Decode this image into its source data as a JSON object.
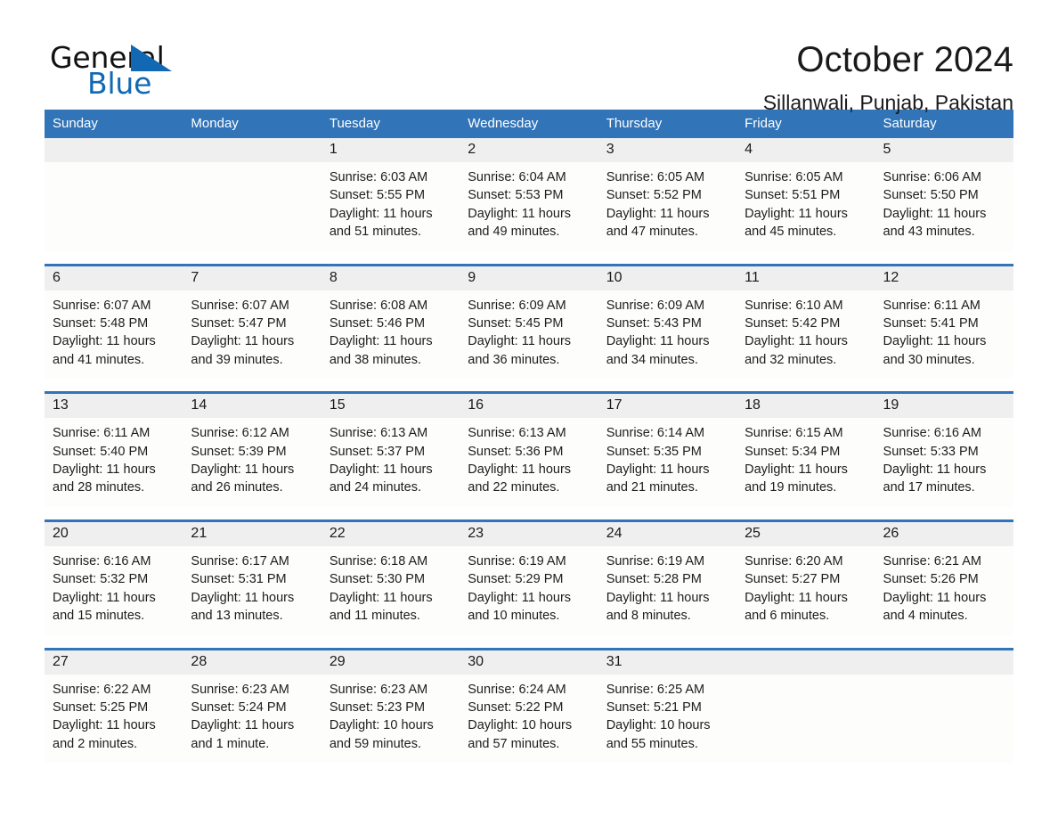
{
  "brand": {
    "name_top": "General",
    "name_bottom": "Blue",
    "flag_icon": "blue-triangle-flag-icon",
    "color_blue": "#1268b3"
  },
  "header": {
    "title": "October 2024",
    "location": "Sillanwali, Punjab, Pakistan"
  },
  "theme": {
    "header_blue": "#3174b7",
    "row_rule_blue": "#3174b7",
    "daynum_band": "#efefef",
    "cell_bg": "#fdfdfc",
    "text": "#1a1a1a"
  },
  "calendar": {
    "weekday_headers": [
      "Sunday",
      "Monday",
      "Tuesday",
      "Wednesday",
      "Thursday",
      "Friday",
      "Saturday"
    ],
    "weeks": [
      [
        {
          "day": "",
          "empty": true
        },
        {
          "day": "",
          "empty": true
        },
        {
          "day": "1",
          "sunrise": "Sunrise: 6:03 AM",
          "sunset": "Sunset: 5:55 PM",
          "daylight_line1": "Daylight: 11 hours",
          "daylight_line2": "and 51 minutes."
        },
        {
          "day": "2",
          "sunrise": "Sunrise: 6:04 AM",
          "sunset": "Sunset: 5:53 PM",
          "daylight_line1": "Daylight: 11 hours",
          "daylight_line2": "and 49 minutes."
        },
        {
          "day": "3",
          "sunrise": "Sunrise: 6:05 AM",
          "sunset": "Sunset: 5:52 PM",
          "daylight_line1": "Daylight: 11 hours",
          "daylight_line2": "and 47 minutes."
        },
        {
          "day": "4",
          "sunrise": "Sunrise: 6:05 AM",
          "sunset": "Sunset: 5:51 PM",
          "daylight_line1": "Daylight: 11 hours",
          "daylight_line2": "and 45 minutes."
        },
        {
          "day": "5",
          "sunrise": "Sunrise: 6:06 AM",
          "sunset": "Sunset: 5:50 PM",
          "daylight_line1": "Daylight: 11 hours",
          "daylight_line2": "and 43 minutes."
        }
      ],
      [
        {
          "day": "6",
          "sunrise": "Sunrise: 6:07 AM",
          "sunset": "Sunset: 5:48 PM",
          "daylight_line1": "Daylight: 11 hours",
          "daylight_line2": "and 41 minutes."
        },
        {
          "day": "7",
          "sunrise": "Sunrise: 6:07 AM",
          "sunset": "Sunset: 5:47 PM",
          "daylight_line1": "Daylight: 11 hours",
          "daylight_line2": "and 39 minutes."
        },
        {
          "day": "8",
          "sunrise": "Sunrise: 6:08 AM",
          "sunset": "Sunset: 5:46 PM",
          "daylight_line1": "Daylight: 11 hours",
          "daylight_line2": "and 38 minutes."
        },
        {
          "day": "9",
          "sunrise": "Sunrise: 6:09 AM",
          "sunset": "Sunset: 5:45 PM",
          "daylight_line1": "Daylight: 11 hours",
          "daylight_line2": "and 36 minutes."
        },
        {
          "day": "10",
          "sunrise": "Sunrise: 6:09 AM",
          "sunset": "Sunset: 5:43 PM",
          "daylight_line1": "Daylight: 11 hours",
          "daylight_line2": "and 34 minutes."
        },
        {
          "day": "11",
          "sunrise": "Sunrise: 6:10 AM",
          "sunset": "Sunset: 5:42 PM",
          "daylight_line1": "Daylight: 11 hours",
          "daylight_line2": "and 32 minutes."
        },
        {
          "day": "12",
          "sunrise": "Sunrise: 6:11 AM",
          "sunset": "Sunset: 5:41 PM",
          "daylight_line1": "Daylight: 11 hours",
          "daylight_line2": "and 30 minutes."
        }
      ],
      [
        {
          "day": "13",
          "sunrise": "Sunrise: 6:11 AM",
          "sunset": "Sunset: 5:40 PM",
          "daylight_line1": "Daylight: 11 hours",
          "daylight_line2": "and 28 minutes."
        },
        {
          "day": "14",
          "sunrise": "Sunrise: 6:12 AM",
          "sunset": "Sunset: 5:39 PM",
          "daylight_line1": "Daylight: 11 hours",
          "daylight_line2": "and 26 minutes."
        },
        {
          "day": "15",
          "sunrise": "Sunrise: 6:13 AM",
          "sunset": "Sunset: 5:37 PM",
          "daylight_line1": "Daylight: 11 hours",
          "daylight_line2": "and 24 minutes."
        },
        {
          "day": "16",
          "sunrise": "Sunrise: 6:13 AM",
          "sunset": "Sunset: 5:36 PM",
          "daylight_line1": "Daylight: 11 hours",
          "daylight_line2": "and 22 minutes."
        },
        {
          "day": "17",
          "sunrise": "Sunrise: 6:14 AM",
          "sunset": "Sunset: 5:35 PM",
          "daylight_line1": "Daylight: 11 hours",
          "daylight_line2": "and 21 minutes."
        },
        {
          "day": "18",
          "sunrise": "Sunrise: 6:15 AM",
          "sunset": "Sunset: 5:34 PM",
          "daylight_line1": "Daylight: 11 hours",
          "daylight_line2": "and 19 minutes."
        },
        {
          "day": "19",
          "sunrise": "Sunrise: 6:16 AM",
          "sunset": "Sunset: 5:33 PM",
          "daylight_line1": "Daylight: 11 hours",
          "daylight_line2": "and 17 minutes."
        }
      ],
      [
        {
          "day": "20",
          "sunrise": "Sunrise: 6:16 AM",
          "sunset": "Sunset: 5:32 PM",
          "daylight_line1": "Daylight: 11 hours",
          "daylight_line2": "and 15 minutes."
        },
        {
          "day": "21",
          "sunrise": "Sunrise: 6:17 AM",
          "sunset": "Sunset: 5:31 PM",
          "daylight_line1": "Daylight: 11 hours",
          "daylight_line2": "and 13 minutes."
        },
        {
          "day": "22",
          "sunrise": "Sunrise: 6:18 AM",
          "sunset": "Sunset: 5:30 PM",
          "daylight_line1": "Daylight: 11 hours",
          "daylight_line2": "and 11 minutes."
        },
        {
          "day": "23",
          "sunrise": "Sunrise: 6:19 AM",
          "sunset": "Sunset: 5:29 PM",
          "daylight_line1": "Daylight: 11 hours",
          "daylight_line2": "and 10 minutes."
        },
        {
          "day": "24",
          "sunrise": "Sunrise: 6:19 AM",
          "sunset": "Sunset: 5:28 PM",
          "daylight_line1": "Daylight: 11 hours",
          "daylight_line2": "and 8 minutes."
        },
        {
          "day": "25",
          "sunrise": "Sunrise: 6:20 AM",
          "sunset": "Sunset: 5:27 PM",
          "daylight_line1": "Daylight: 11 hours",
          "daylight_line2": "and 6 minutes."
        },
        {
          "day": "26",
          "sunrise": "Sunrise: 6:21 AM",
          "sunset": "Sunset: 5:26 PM",
          "daylight_line1": "Daylight: 11 hours",
          "daylight_line2": "and 4 minutes."
        }
      ],
      [
        {
          "day": "27",
          "sunrise": "Sunrise: 6:22 AM",
          "sunset": "Sunset: 5:25 PM",
          "daylight_line1": "Daylight: 11 hours",
          "daylight_line2": "and 2 minutes."
        },
        {
          "day": "28",
          "sunrise": "Sunrise: 6:23 AM",
          "sunset": "Sunset: 5:24 PM",
          "daylight_line1": "Daylight: 11 hours",
          "daylight_line2": "and 1 minute."
        },
        {
          "day": "29",
          "sunrise": "Sunrise: 6:23 AM",
          "sunset": "Sunset: 5:23 PM",
          "daylight_line1": "Daylight: 10 hours",
          "daylight_line2": "and 59 minutes."
        },
        {
          "day": "30",
          "sunrise": "Sunrise: 6:24 AM",
          "sunset": "Sunset: 5:22 PM",
          "daylight_line1": "Daylight: 10 hours",
          "daylight_line2": "and 57 minutes."
        },
        {
          "day": "31",
          "sunrise": "Sunrise: 6:25 AM",
          "sunset": "Sunset: 5:21 PM",
          "daylight_line1": "Daylight: 10 hours",
          "daylight_line2": "and 55 minutes."
        },
        {
          "day": "",
          "empty": true
        },
        {
          "day": "",
          "empty": true
        }
      ]
    ]
  }
}
